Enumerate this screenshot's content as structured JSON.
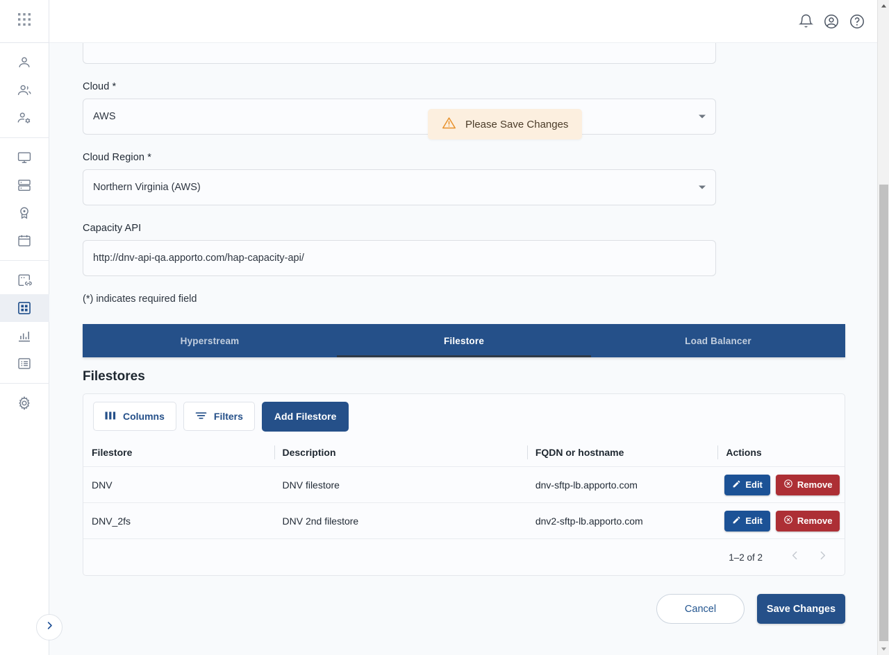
{
  "sidebar": {
    "logo_icon": "apps-grid-icon",
    "groups": [
      {
        "items": [
          {
            "name": "sidebar-item-user",
            "icon": "user-icon"
          },
          {
            "name": "sidebar-item-users",
            "icon": "users-icon"
          },
          {
            "name": "sidebar-item-user-settings",
            "icon": "user-gear-icon"
          }
        ]
      },
      {
        "items": [
          {
            "name": "sidebar-item-desktops",
            "icon": "monitor-icon"
          },
          {
            "name": "sidebar-item-servers",
            "icon": "server-icon"
          },
          {
            "name": "sidebar-item-licenses",
            "icon": "award-icon"
          },
          {
            "name": "sidebar-item-schedule",
            "icon": "calendar-icon"
          }
        ]
      },
      {
        "items": [
          {
            "name": "sidebar-item-integrations",
            "icon": "link-card-icon"
          },
          {
            "name": "sidebar-item-infrastructure",
            "icon": "grid-squares-icon",
            "active": true
          },
          {
            "name": "sidebar-item-reports",
            "icon": "bar-chart-icon"
          },
          {
            "name": "sidebar-item-logs",
            "icon": "list-icon"
          }
        ]
      },
      {
        "items": [
          {
            "name": "sidebar-item-settings",
            "icon": "gear-icon"
          }
        ]
      }
    ],
    "expand_icon": "chevron-right-icon"
  },
  "topbar": {
    "icons": [
      {
        "name": "notifications-icon",
        "icon": "bell-icon"
      },
      {
        "name": "account-icon",
        "icon": "account-circle-icon"
      },
      {
        "name": "help-icon",
        "icon": "question-circle-icon"
      }
    ]
  },
  "toast": {
    "icon": "warning-triangle-icon",
    "message": "Please Save Changes",
    "bg_color": "#fcefdf",
    "icon_color": "#e8902a"
  },
  "form": {
    "fields": [
      {
        "label": "Cloud *",
        "value": "AWS",
        "type": "select"
      },
      {
        "label": "Cloud Region *",
        "value": "Northern Virginia (AWS)",
        "type": "select"
      },
      {
        "label": "Capacity API",
        "value": "http://dnv-api-qa.apporto.com/hap-capacity-api/",
        "type": "text"
      }
    ],
    "required_note": "(*) indicates required field"
  },
  "tabs": {
    "items": [
      {
        "label": "Hyperstream",
        "active": false
      },
      {
        "label": "Filestore",
        "active": true
      },
      {
        "label": "Load Balancer",
        "active": false
      }
    ],
    "bg_color": "#255089"
  },
  "section": {
    "title": "Filestores"
  },
  "toolbar": {
    "columns_label": "Columns",
    "columns_icon": "columns-icon",
    "filters_label": "Filters",
    "filters_icon": "filter-list-icon",
    "add_label": "Add Filestore"
  },
  "table": {
    "columns": [
      "Filestore",
      "Description",
      "FQDN or hostname",
      "Actions"
    ],
    "rows": [
      {
        "filestore": "DNV",
        "description": "DNV filestore",
        "fqdn": "dnv-sftp-lb.apporto.com",
        "edit_label": "Edit",
        "remove_label": "Remove"
      },
      {
        "filestore": "DNV_2fs",
        "description": "DNV 2nd filestore",
        "fqdn": "dnv2-sftp-lb.apporto.com",
        "edit_label": "Edit",
        "remove_label": "Remove"
      }
    ],
    "edit_icon": "pencil-icon",
    "remove_icon": "circle-x-icon",
    "pagination": {
      "label": "1–2 of 2",
      "prev_icon": "chevron-left-icon",
      "next_icon": "chevron-right-icon"
    }
  },
  "footer": {
    "cancel_label": "Cancel",
    "save_label": "Save Changes"
  },
  "colors": {
    "accent": "#255089",
    "danger": "#ad2f35",
    "page_bg": "#f8fafc"
  }
}
